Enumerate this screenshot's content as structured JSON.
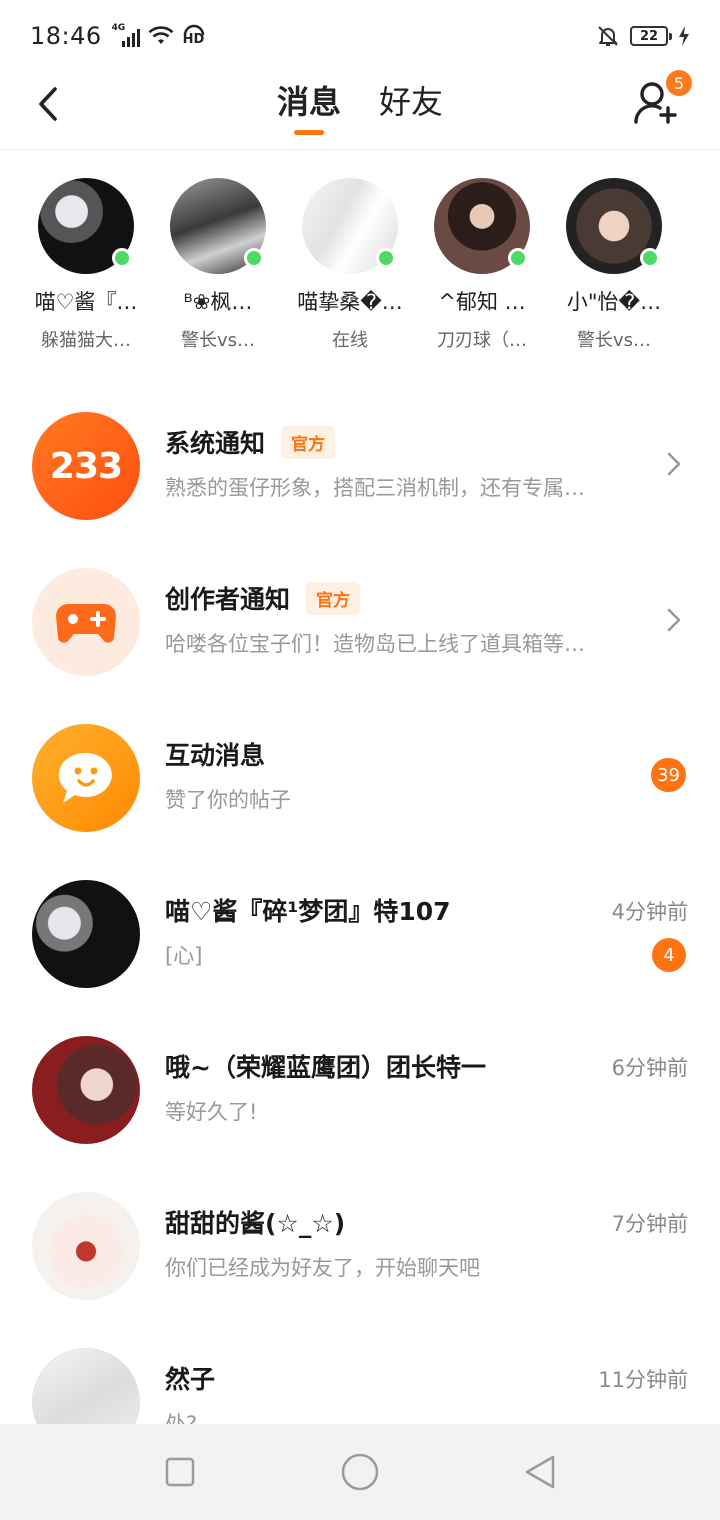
{
  "status_bar": {
    "time": "18:46",
    "network": "4G",
    "hd_label": "HD",
    "battery": "22"
  },
  "header": {
    "tabs": [
      {
        "label": "消息",
        "active": true
      },
      {
        "label": "好友",
        "active": false
      }
    ],
    "add_friend_badge": "5"
  },
  "online_friends": [
    {
      "name": "喵♡酱『…",
      "status": "躲猫猫大…",
      "online": true
    },
    {
      "name": "ᴮ❀枫…",
      "status": "警长vs…",
      "online": true
    },
    {
      "name": "喵挚桑�…",
      "status": "在线",
      "online": true
    },
    {
      "name": "^郁知 …",
      "status": "刀刃球（…",
      "online": true
    },
    {
      "name": "小\"怡�…",
      "status": "警长vs…",
      "online": true
    }
  ],
  "messages": [
    {
      "title": "系统通知",
      "tag": "官方",
      "preview": "熟悉的蛋仔形象，搭配三消机制，还有专属…",
      "avatar_text": "233",
      "chevron": true
    },
    {
      "title": "创作者通知",
      "tag": "官方",
      "preview": "哈喽各位宝子们！造物岛已上线了道具箱等…",
      "chevron": true
    },
    {
      "title": "互动消息",
      "preview": "赞了你的帖子",
      "badge": "39"
    },
    {
      "title": "喵♡酱『碎¹梦团』特107",
      "preview": "[心]",
      "time": "4分钟前",
      "badge": "4"
    },
    {
      "title": "哦~（荣耀蓝鹰团）团长特一",
      "preview": "等好久了!",
      "time": "6分钟前"
    },
    {
      "title": "甜甜的酱(☆_☆)",
      "preview": "你们已经成为好友了，开始聊天吧",
      "time": "7分钟前"
    },
    {
      "title": "然子",
      "preview": "处?",
      "time": "11分钟前"
    }
  ],
  "colors": {
    "accent": "#ff7310",
    "online": "#4cd964",
    "badge": "#ff7310"
  }
}
